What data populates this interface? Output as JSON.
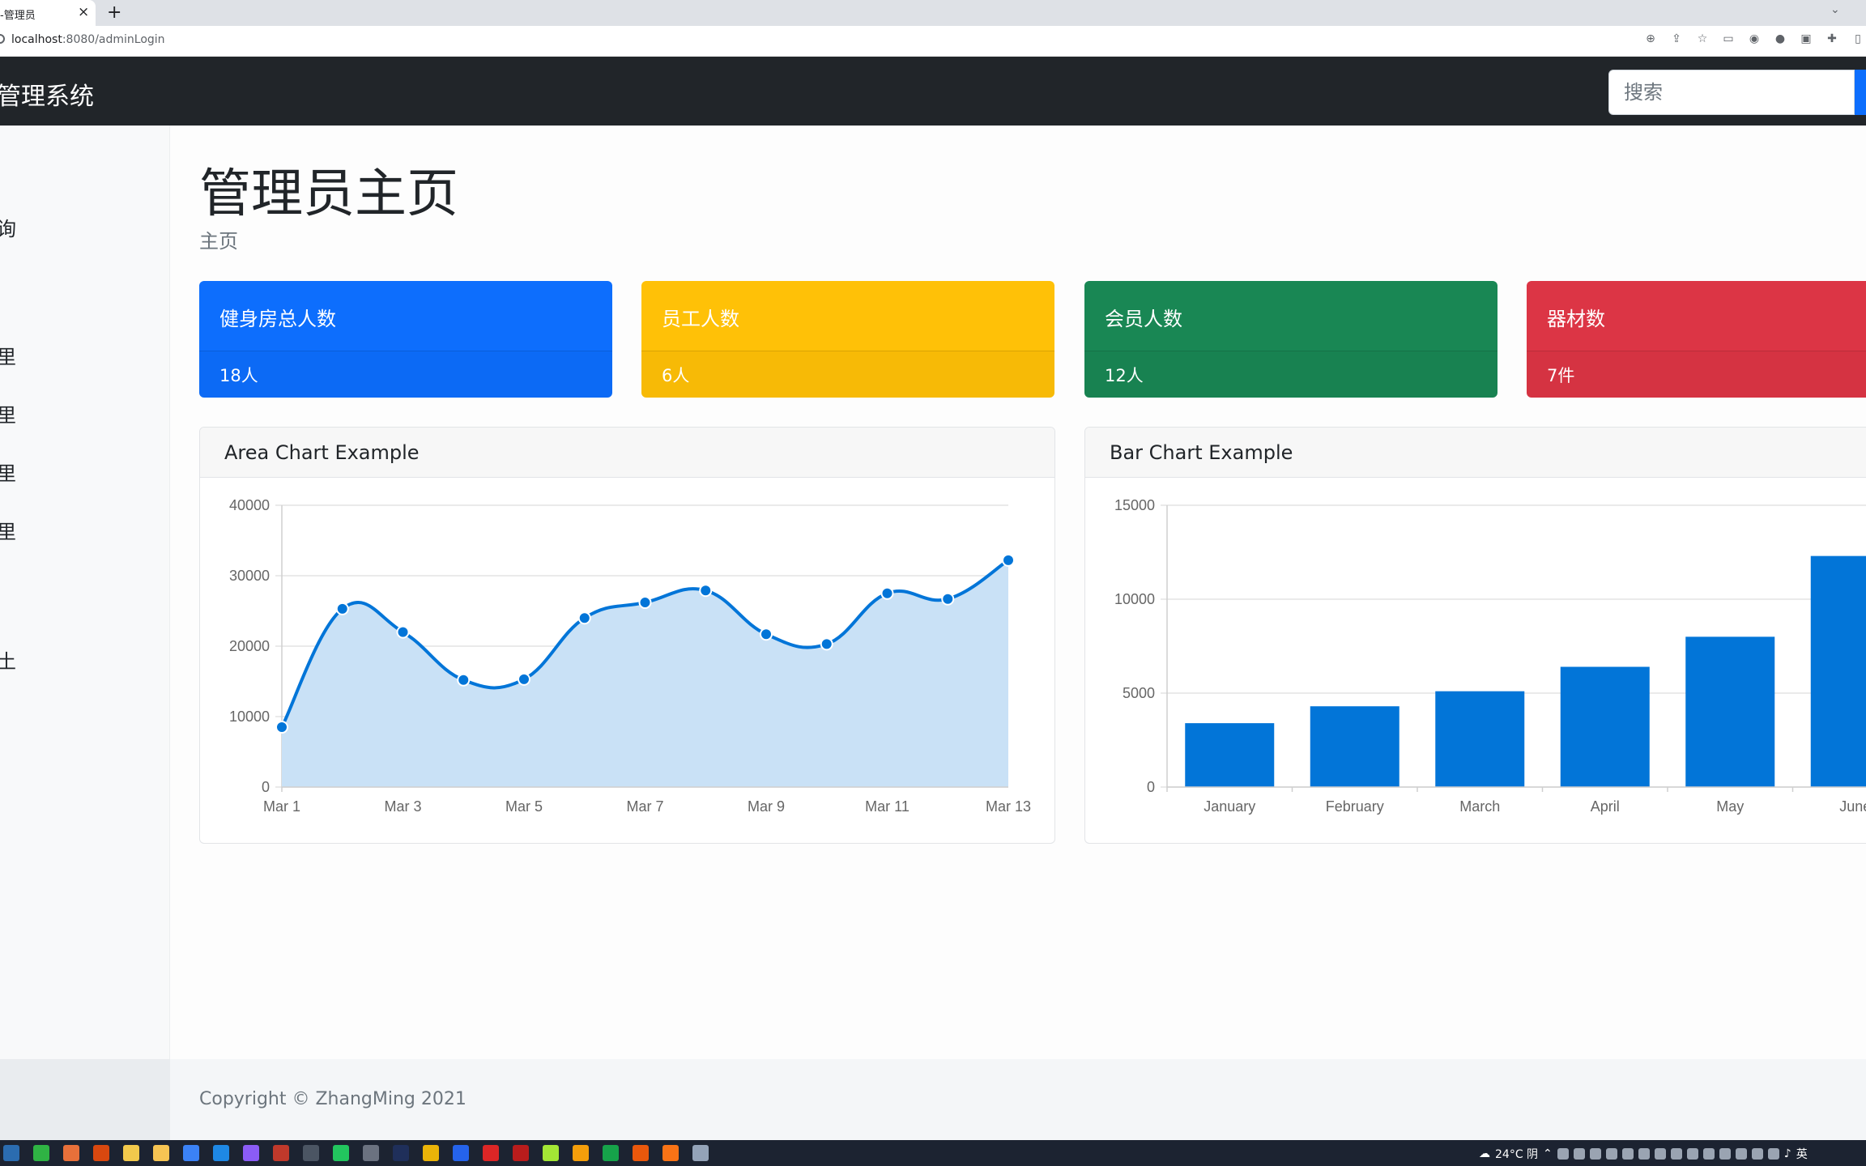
{
  "browser": {
    "tab_title": "-管理员",
    "tab_close": "×",
    "new_tab": "+",
    "url_host": "localhost",
    "url_rest": ":8080/adminLogin"
  },
  "navbar": {
    "brand": "管理系统",
    "search_placeholder": "搜索"
  },
  "sidebar": {
    "items": [
      "询",
      "里",
      "里",
      "里",
      "里",
      "土"
    ]
  },
  "page": {
    "title": "管理员主页",
    "breadcrumb": "主页"
  },
  "cards": [
    {
      "title": "健身房总人数",
      "value": "18人",
      "color": "#0d6efd"
    },
    {
      "title": "员工人数",
      "value": "6人",
      "color": "#ffc107"
    },
    {
      "title": "会员人数",
      "value": "12人",
      "color": "#198754"
    },
    {
      "title": "器材数",
      "value": "7件",
      "color": "#dc3545"
    }
  ],
  "chart_data": [
    {
      "type": "area",
      "title": "Area Chart Example",
      "x": [
        "Mar 1",
        "Mar 2",
        "Mar 3",
        "Mar 4",
        "Mar 5",
        "Mar 6",
        "Mar 7",
        "Mar 8",
        "Mar 9",
        "Mar 10",
        "Mar 11",
        "Mar 12",
        "Mar 13"
      ],
      "x_tick_labels": [
        "Mar 1",
        "Mar 3",
        "Mar 5",
        "Mar 7",
        "Mar 9",
        "Mar 11",
        "Mar 13"
      ],
      "values": [
        8500,
        25300,
        22000,
        15200,
        15300,
        24000,
        26200,
        27900,
        21700,
        20300,
        27500,
        26700,
        32200
      ],
      "ylim": [
        0,
        40000
      ],
      "y_ticks": [
        0,
        10000,
        20000,
        30000,
        40000
      ],
      "grid": true,
      "line_color": "#0275d8",
      "fill_color": "#c9e1f6"
    },
    {
      "type": "bar",
      "title": "Bar Chart Example",
      "categories": [
        "January",
        "February",
        "March",
        "April",
        "May",
        "June"
      ],
      "values": [
        3400,
        4300,
        5100,
        6400,
        8000,
        12300
      ],
      "ylim": [
        0,
        15000
      ],
      "y_ticks": [
        0,
        5000,
        10000,
        15000
      ],
      "grid": true,
      "bar_color": "#0275d8"
    }
  ],
  "footer": {
    "copyright": "Copyright © ZhangMing 2021"
  },
  "taskbar": {
    "weather": "24°C 阴",
    "lang": "英"
  }
}
